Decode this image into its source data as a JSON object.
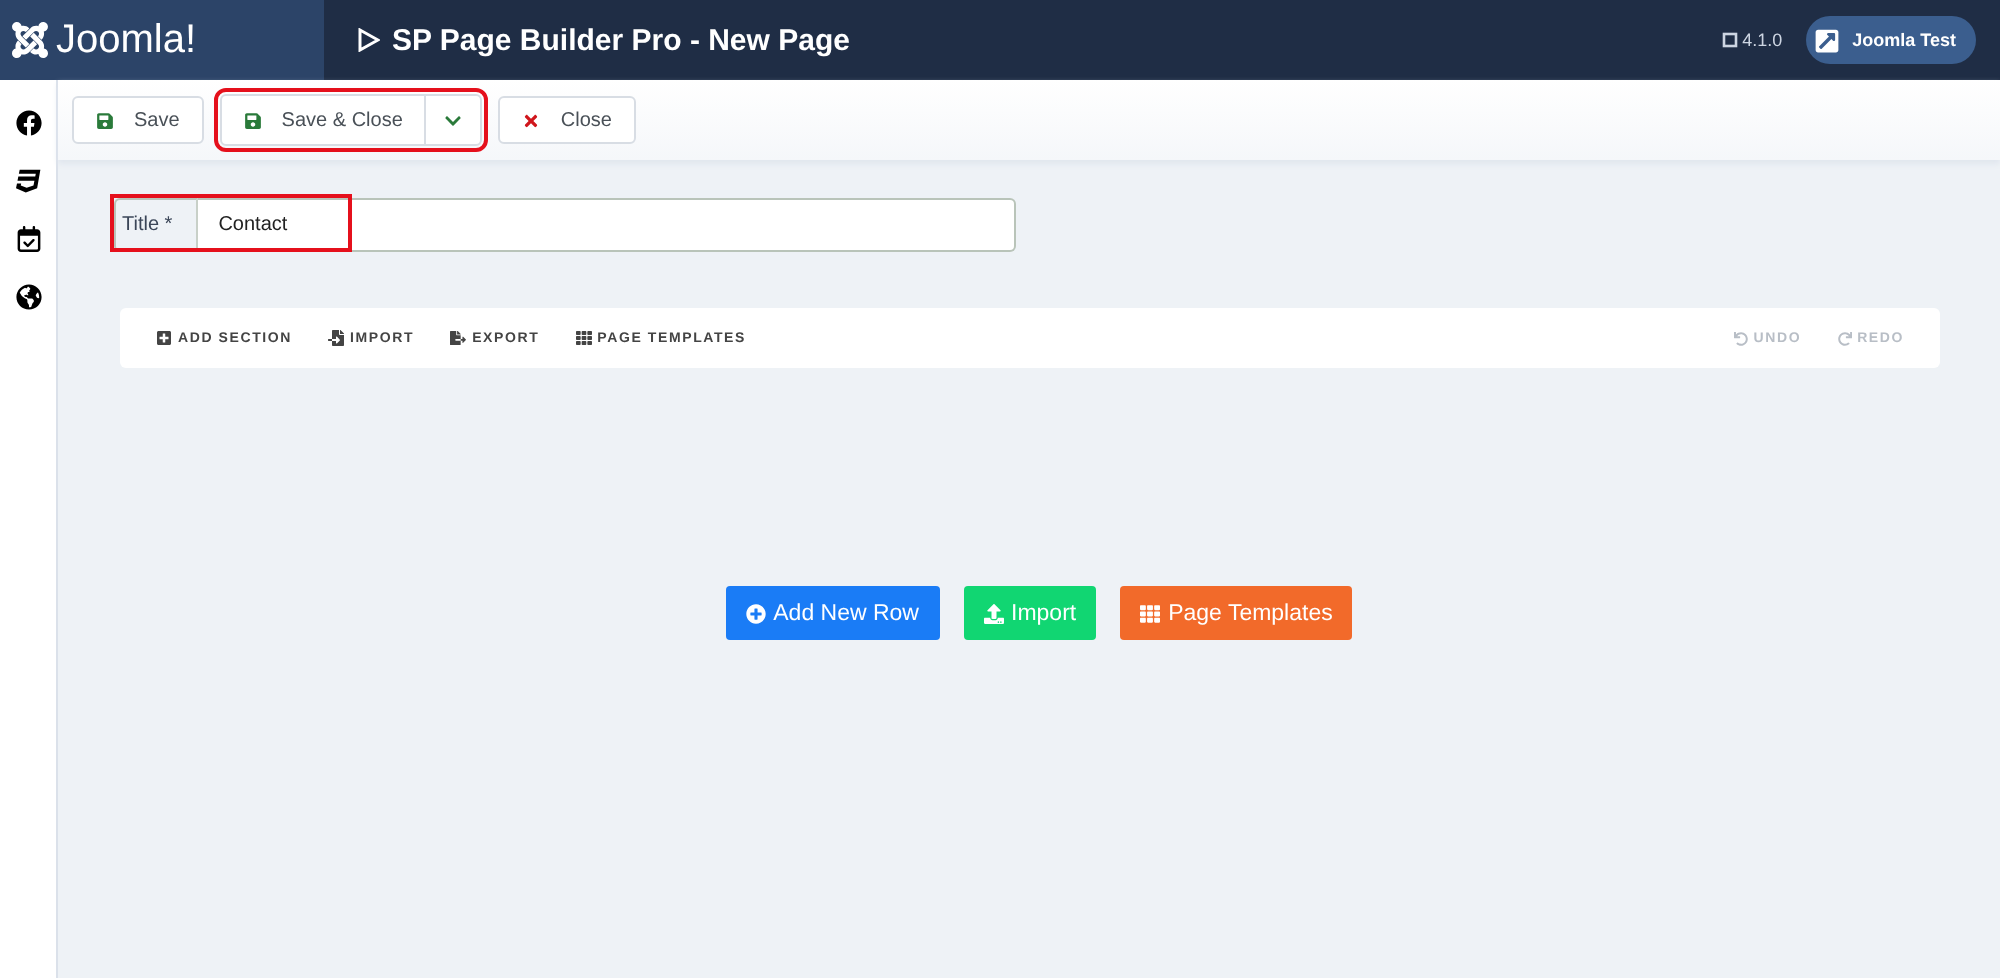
{
  "header": {
    "logo": "Joomla!",
    "page_title": "SP Page Builder Pro - New Page",
    "version": "4.1.0",
    "user_button": "Joomla Test"
  },
  "toolbar": {
    "buttons": [
      {
        "kind": "save",
        "label": "Save",
        "highlighted": false
      },
      {
        "kind": "save-close",
        "label": "Save & Close",
        "highlighted": true
      },
      {
        "kind": "close",
        "label": "Close",
        "highlighted": false
      }
    ]
  },
  "title_field": {
    "label": "Title *",
    "value": "Contact",
    "highlighted": true
  },
  "builder_toolbar": {
    "actions": [
      {
        "kind": "add-section",
        "label": "ADD SECTION",
        "disabled": false
      },
      {
        "kind": "import",
        "label": "IMPORT",
        "disabled": false
      },
      {
        "kind": "export",
        "label": "EXPORT",
        "disabled": false
      },
      {
        "kind": "templates",
        "label": "PAGE TEMPLATES",
        "disabled": false
      }
    ],
    "history": [
      {
        "kind": "undo",
        "label": "UNDO",
        "disabled": true
      },
      {
        "kind": "redo",
        "label": "REDO",
        "disabled": true
      }
    ]
  },
  "empty_actions": [
    {
      "kind": "add-row",
      "label": "Add New Row",
      "color": "#1a7cf6"
    },
    {
      "kind": "import",
      "label": "Import",
      "color": "#11d672"
    },
    {
      "kind": "templates",
      "label": "Page Templates",
      "color": "#f26a2a"
    }
  ]
}
